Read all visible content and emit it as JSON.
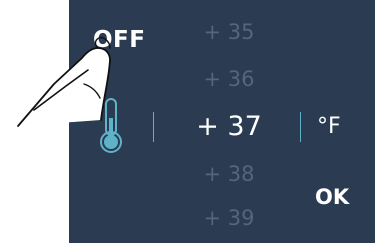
{
  "controls": {
    "off_label": "OFF",
    "ok_label": "OK",
    "unit_label": "°F"
  },
  "temperature_picker": {
    "values": [
      "+ 35",
      "+ 36",
      "+ 37",
      "+ 38",
      "+ 39"
    ],
    "selected": "+ 37"
  },
  "colors": {
    "panel_background": "#2b3b51",
    "accent": "#5fb3c9",
    "dim_text": "#56657a",
    "text": "#ffffff"
  },
  "icons": {
    "thermometer": "thermometer-icon",
    "hand": "pointing-hand-icon"
  }
}
